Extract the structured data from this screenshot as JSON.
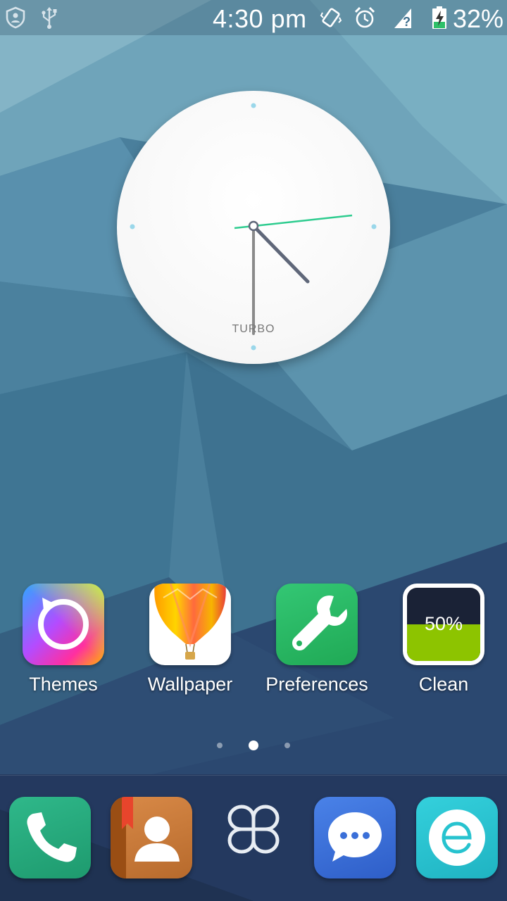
{
  "status_bar": {
    "time": "4:30 pm",
    "battery_percent": "32%",
    "battery_level": 0.32,
    "icons": [
      "shield-user-icon",
      "usb-icon",
      "vibrate-icon",
      "alarm-icon",
      "no-signal-icon",
      "battery-charging-icon"
    ]
  },
  "clock_widget": {
    "brand": "TURBO",
    "time_shown": "4:30",
    "hour_hand_color": "#5f6779",
    "minute_hand_color": "#8a8a8a",
    "second_hand_color": "#2ecc8f"
  },
  "apps": [
    {
      "label": "Themes",
      "icon": "themes-icon"
    },
    {
      "label": "Wallpaper",
      "icon": "hot-air-balloon-icon"
    },
    {
      "label": "Preferences",
      "icon": "wrench-icon"
    },
    {
      "label": "Clean",
      "icon": "clean-battery-icon",
      "value": "50%"
    }
  ],
  "page_indicator": {
    "total": 3,
    "current": 2
  },
  "dock": [
    {
      "icon": "phone-icon"
    },
    {
      "icon": "contacts-icon"
    },
    {
      "icon": "app-drawer-icon"
    },
    {
      "icon": "messages-icon"
    },
    {
      "icon": "browser-icon"
    }
  ],
  "colors": {
    "accent_green": "#2dc069",
    "clean_green": "#8dc400",
    "messages_blue": "#3a6fd8",
    "browser_teal": "#27c3cf"
  }
}
